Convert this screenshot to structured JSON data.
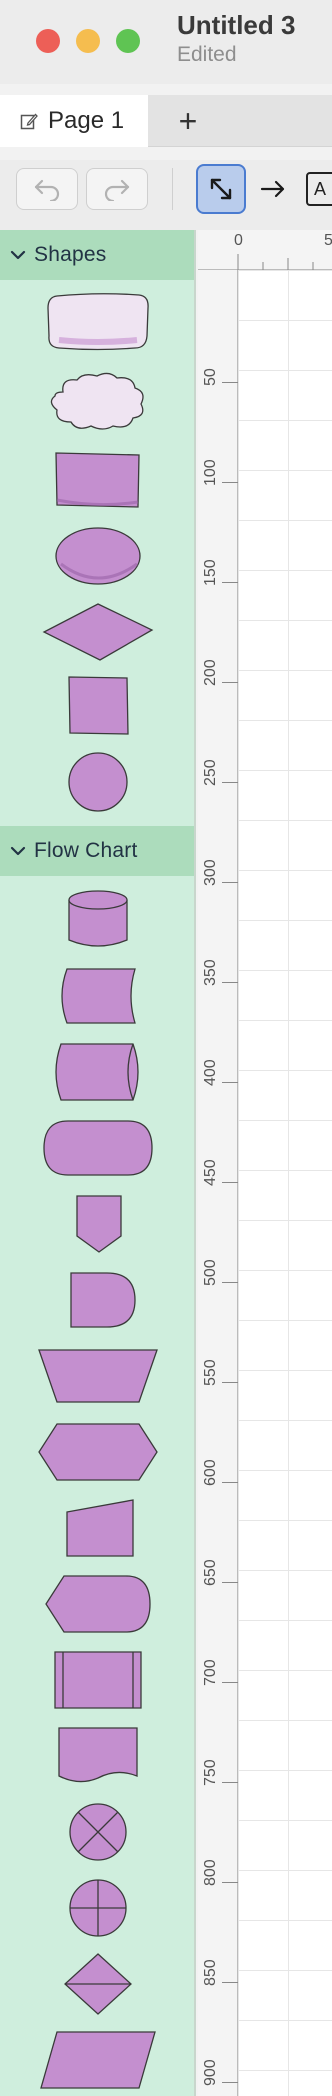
{
  "window": {
    "title": "Untitled 3",
    "status": "Edited"
  },
  "tabs": [
    {
      "label": "Page 1",
      "active": true
    }
  ],
  "add_tab_symbol": "+",
  "toolbar": {
    "text_tool_label": "A"
  },
  "sidebar": {
    "sections": [
      {
        "label": "Shapes"
      },
      {
        "label": "Flow Chart"
      }
    ]
  },
  "colors": {
    "shape_fill": "#c48fcf",
    "shape_fill_light": "#efe4f2",
    "sidebar_bg": "#cfeedd",
    "section_header_bg": "#acdcbc",
    "accent": "#4a7bd0"
  },
  "ruler": {
    "top_ticks": [
      "0",
      "5"
    ],
    "left_ticks": [
      "50",
      "100",
      "150",
      "200",
      "250",
      "300",
      "350",
      "400",
      "450",
      "500",
      "550",
      "600",
      "650",
      "700",
      "750",
      "800",
      "850",
      "900"
    ]
  }
}
